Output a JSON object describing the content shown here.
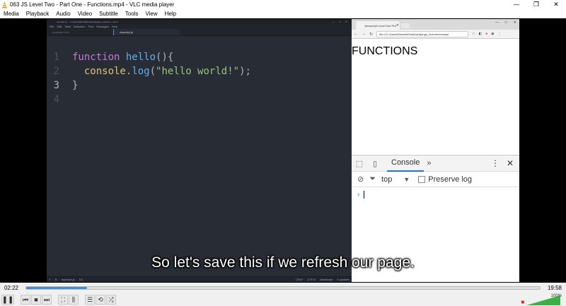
{
  "window": {
    "title": "063 JS Level Two - Part One - Functions.mp4 - VLC media player",
    "minimize": "—",
    "restore": "❐",
    "close": "✕"
  },
  "menu": [
    "Media",
    "Playback",
    "Audio",
    "Video",
    "Subtitle",
    "Tools",
    "View",
    "Help"
  ],
  "editor": {
    "title": "example.js — C:\\Users\\Marcial\\Desktop\\django_lectures — Atom",
    "menu": [
      "File",
      "Edit",
      "View",
      "Selection",
      "Find",
      "Packages",
      "Help"
    ],
    "tabs": [
      "example.html",
      "myscript.js"
    ],
    "active_tab": 1,
    "line_numbers": [
      "1",
      "2",
      "3",
      "4"
    ],
    "code": {
      "l1_kw": "function",
      "l1_fn": "hello",
      "l1_rest": "(){",
      "l2_obj": "console",
      "l2_dot": ".",
      "l2_fn": "log",
      "l2_open": "(",
      "l2_str": "\"hello world!\"",
      "l2_close": ");",
      "l3": "}"
    },
    "status": {
      "file": "myscript.js",
      "pos": "3:2",
      "eol": "CRLF",
      "enc": "UTF-8",
      "grammar": "JavaScript",
      "updates": "3 updates"
    }
  },
  "browser": {
    "tab_title": "Javascript Level One Pra",
    "url": "file:///C:/Users/Marcial/Desktop/django_lectures/exampl",
    "heading": "FUNCTIONS",
    "devtools": {
      "tab": "Console",
      "more": "»",
      "context": "top",
      "preserve_log": "Preserve log",
      "prompt": "›"
    }
  },
  "subtitle": "So let's save this if we refresh our page.",
  "player": {
    "elapsed": "02:22",
    "total": "19:58",
    "progress": 0.119,
    "volume": "100%"
  }
}
